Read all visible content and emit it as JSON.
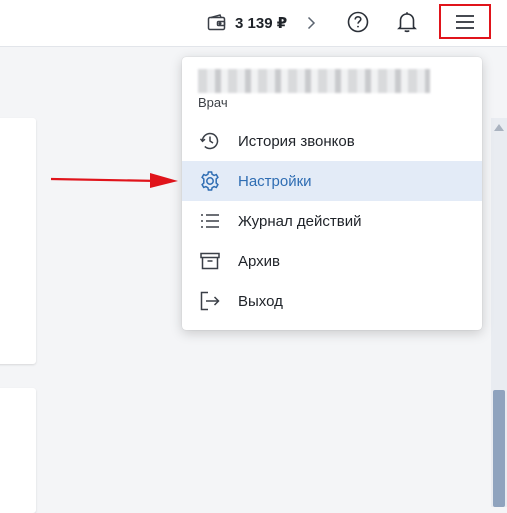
{
  "header": {
    "balance": "3 139 ₽",
    "icons": {
      "wallet": "wallet-icon",
      "balance_more": "chevron-right-icon",
      "help": "help-circle-icon",
      "notifications": "bell-icon",
      "menu": "hamburger-menu-icon"
    }
  },
  "dropdown": {
    "user_role": "Врач",
    "items": [
      {
        "label": "История звонков",
        "icon": "history-icon",
        "active": false
      },
      {
        "label": "Настройки",
        "icon": "gear-icon",
        "active": true
      },
      {
        "label": "Журнал действий",
        "icon": "list-icon",
        "active": false
      },
      {
        "label": "Архив",
        "icon": "archive-icon",
        "active": false
      },
      {
        "label": "Выход",
        "icon": "logout-icon",
        "active": false
      }
    ]
  },
  "annotations": {
    "highlight_color": "#e0141b",
    "active_item_color": "#2f6db3"
  }
}
